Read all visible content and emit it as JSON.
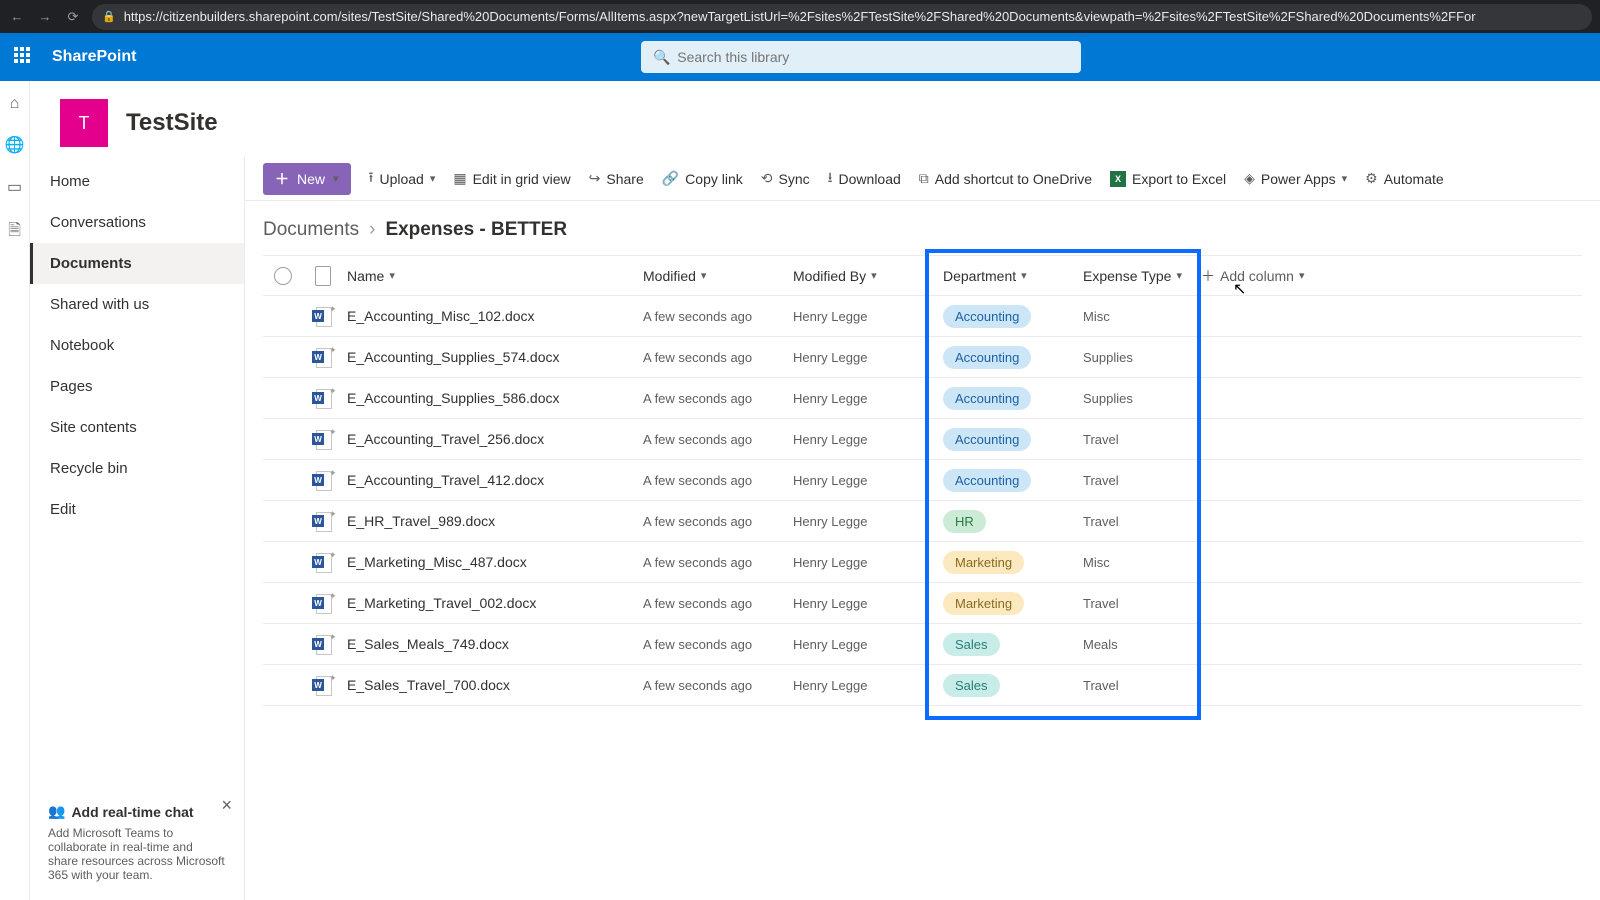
{
  "browser": {
    "url": "https://citizenbuilders.sharepoint.com/sites/TestSite/Shared%20Documents/Forms/AllItems.aspx?newTargetListUrl=%2Fsites%2FTestSite%2FShared%20Documents&viewpath=%2Fsites%2FTestSite%2FShared%20Documents%2FFor"
  },
  "sharepoint": {
    "brand": "SharePoint",
    "search_placeholder": "Search this library"
  },
  "site": {
    "logo_letter": "T",
    "title": "TestSite"
  },
  "leftnav": {
    "items": [
      "Home",
      "Conversations",
      "Documents",
      "Shared with us",
      "Notebook",
      "Pages",
      "Site contents",
      "Recycle bin",
      "Edit"
    ],
    "selected_index": 2
  },
  "chat_card": {
    "title": "Add real-time chat",
    "body": "Add Microsoft Teams to collaborate in real-time and share resources across Microsoft 365 with your team."
  },
  "cmdbar": {
    "new": "New",
    "upload": "Upload",
    "edit_grid": "Edit in grid view",
    "share": "Share",
    "copy_link": "Copy link",
    "sync": "Sync",
    "download": "Download",
    "onedrive": "Add shortcut to OneDrive",
    "excel": "Export to Excel",
    "power_apps": "Power Apps",
    "automate": "Automate"
  },
  "breadcrumb": {
    "root": "Documents",
    "current": "Expenses - BETTER"
  },
  "columns": {
    "name": "Name",
    "modified": "Modified",
    "modified_by": "Modified By",
    "department": "Department",
    "expense_type": "Expense Type",
    "add_column": "Add column"
  },
  "rows": [
    {
      "name": "E_Accounting_Misc_102.docx",
      "modified": "A few seconds ago",
      "by": "Henry Legge",
      "dept": "Accounting",
      "dept_class": "accounting",
      "exp": "Misc"
    },
    {
      "name": "E_Accounting_Supplies_574.docx",
      "modified": "A few seconds ago",
      "by": "Henry Legge",
      "dept": "Accounting",
      "dept_class": "accounting",
      "exp": "Supplies"
    },
    {
      "name": "E_Accounting_Supplies_586.docx",
      "modified": "A few seconds ago",
      "by": "Henry Legge",
      "dept": "Accounting",
      "dept_class": "accounting",
      "exp": "Supplies"
    },
    {
      "name": "E_Accounting_Travel_256.docx",
      "modified": "A few seconds ago",
      "by": "Henry Legge",
      "dept": "Accounting",
      "dept_class": "accounting",
      "exp": "Travel"
    },
    {
      "name": "E_Accounting_Travel_412.docx",
      "modified": "A few seconds ago",
      "by": "Henry Legge",
      "dept": "Accounting",
      "dept_class": "accounting",
      "exp": "Travel"
    },
    {
      "name": "E_HR_Travel_989.docx",
      "modified": "A few seconds ago",
      "by": "Henry Legge",
      "dept": "HR",
      "dept_class": "hr",
      "exp": "Travel"
    },
    {
      "name": "E_Marketing_Misc_487.docx",
      "modified": "A few seconds ago",
      "by": "Henry Legge",
      "dept": "Marketing",
      "dept_class": "marketing",
      "exp": "Misc"
    },
    {
      "name": "E_Marketing_Travel_002.docx",
      "modified": "A few seconds ago",
      "by": "Henry Legge",
      "dept": "Marketing",
      "dept_class": "marketing",
      "exp": "Travel"
    },
    {
      "name": "E_Sales_Meals_749.docx",
      "modified": "A few seconds ago",
      "by": "Henry Legge",
      "dept": "Sales",
      "dept_class": "sales",
      "exp": "Meals"
    },
    {
      "name": "E_Sales_Travel_700.docx",
      "modified": "A few seconds ago",
      "by": "Henry Legge",
      "dept": "Sales",
      "dept_class": "sales",
      "exp": "Travel"
    }
  ]
}
